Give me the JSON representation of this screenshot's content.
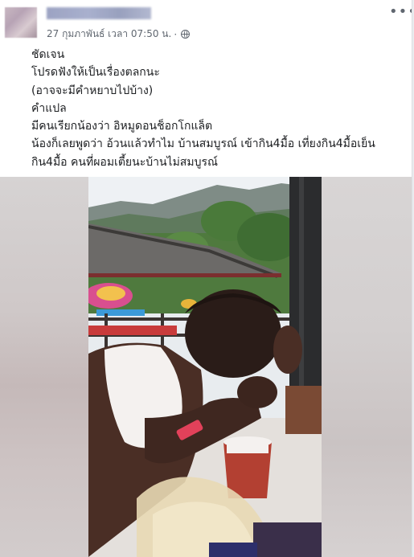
{
  "post": {
    "timestamp": "27 กุมภาพันธ์ เวลา 07:50 น.",
    "separator": "·",
    "more_label": "•••",
    "lines": [
      "ชัดเจน",
      "โปรดฟังให้เป็นเรื่องตลกนะ",
      "(อาจจะมีคำหยาบไปบ้าง)",
      "คำแปล",
      "มีคนเรียกน้องว่า อิหมูดอนช็อกโกแล็ต",
      "น้องก็เลยพูดว่า อ้วนแล้วทำไม บ้านสมบูรณ์ เข้ากิน4มื้อ เที่ยงกิน4มื้อเย็น",
      "กิน4มื้อ คนที่ผอมเตี้ยนะบ้านไม่สมบูรณ์"
    ]
  },
  "icons": {
    "privacy": "globe-icon",
    "more": "more-options-icon"
  }
}
